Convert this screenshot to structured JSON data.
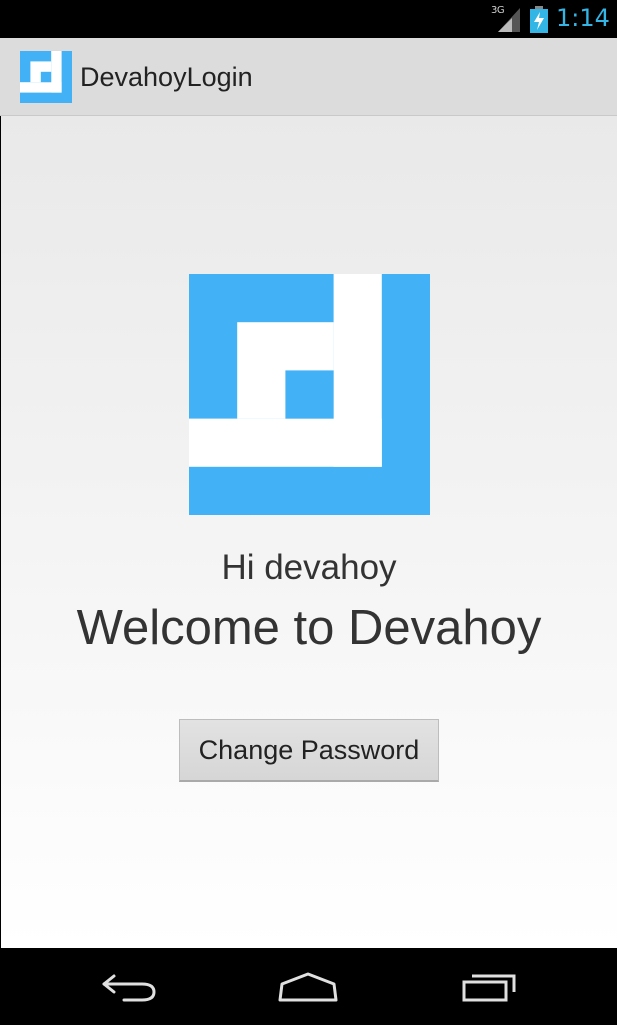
{
  "status_bar": {
    "network_type": "3G",
    "time": "1:14",
    "accent_color": "#33b5e5"
  },
  "action_bar": {
    "app_icon": "devahoy-logo-icon",
    "title": "DevahoyLogin"
  },
  "content": {
    "logo": "devahoy-logo-icon",
    "greeting": "Hi devahoy",
    "welcome": "Welcome to Devahoy",
    "change_password_label": "Change Password",
    "brand_color": "#42b1f5"
  },
  "nav_bar": {
    "buttons": [
      "back-icon",
      "home-icon",
      "recent-apps-icon"
    ]
  }
}
